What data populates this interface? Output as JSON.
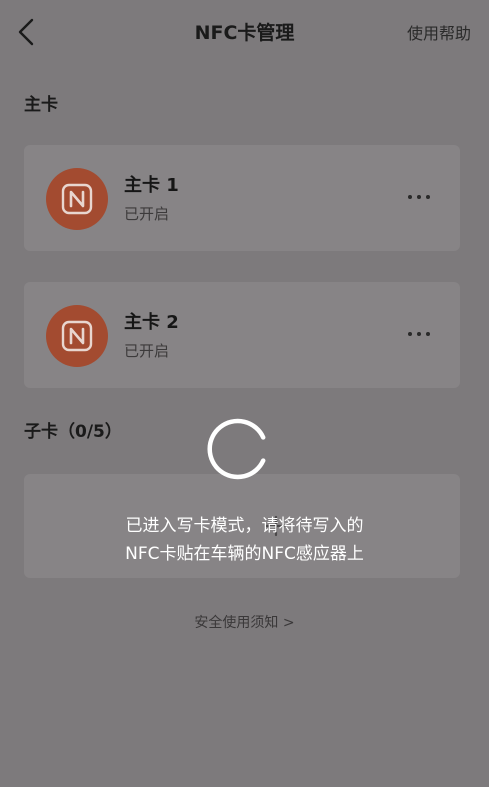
{
  "header": {
    "title": "NFC卡管理",
    "help_label": "使用帮助"
  },
  "main_section": {
    "title": "主卡",
    "cards": [
      {
        "name": "主卡 1",
        "status": "已开启"
      },
      {
        "name": "主卡 2",
        "status": "已开启"
      }
    ]
  },
  "sub_section": {
    "title": "子卡（0/5）"
  },
  "safety_link": "安全使用须知 >",
  "overlay": {
    "message_line1": "已进入写卡模式，请将待写入的",
    "message_line2": "NFC卡贴在车辆的NFC感应器上"
  },
  "colors": {
    "nfc_badge": "#a34b30",
    "overlay_text": "#ffffff"
  }
}
